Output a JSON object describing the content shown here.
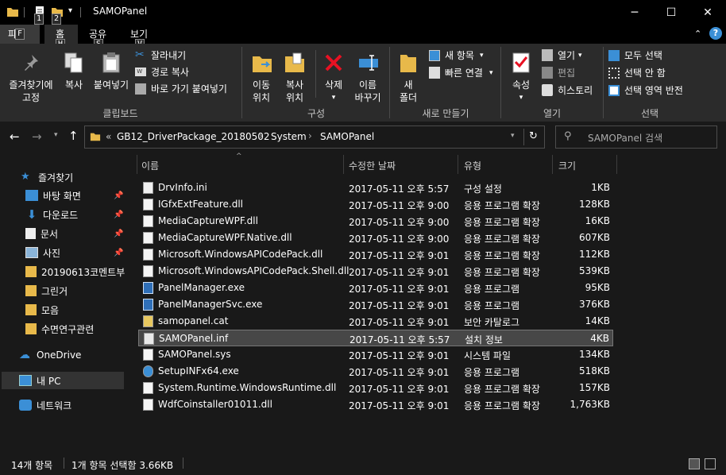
{
  "window": {
    "title": "SAMOPanel",
    "minimize": "─",
    "maximize": "☐",
    "close": "✕"
  },
  "quick_access": {
    "keytips": [
      "1",
      "2"
    ]
  },
  "ribbon_tabs": [
    {
      "label": "파일",
      "keytip": "F"
    },
    {
      "label": "홈",
      "keytip": "H"
    },
    {
      "label": "공유",
      "keytip": "S"
    },
    {
      "label": "보기",
      "keytip": "V"
    }
  ],
  "ribbon": {
    "clipboard": {
      "pin_label": [
        "즐겨찾기에",
        "고정"
      ],
      "copy": "복사",
      "paste": "붙여넣기",
      "cut": "잘라내기",
      "copy_path": "경로 복사",
      "paste_shortcut": "바로 가기 붙여넣기",
      "group": "클립보드"
    },
    "organize": {
      "move_to": [
        "이동",
        "위치"
      ],
      "copy_to": [
        "복사",
        "위치"
      ],
      "delete": "삭제",
      "rename": [
        "이름",
        "바꾸기"
      ],
      "group": "구성"
    },
    "new": {
      "new_folder": [
        "새",
        "폴더"
      ],
      "new_item": "새 항목",
      "easy_access": "빠른 연결",
      "group": "새로 만들기"
    },
    "open": {
      "properties": "속성",
      "open": "열기",
      "edit": "편집",
      "history": "히스토리",
      "group": "열기"
    },
    "select": {
      "select_all": "모두 선택",
      "select_none": "선택 안 함",
      "invert": "선택 영역 반전",
      "group": "선택"
    }
  },
  "address": {
    "overflow": "«",
    "crumbs": [
      "GB12_DriverPackage_20180502",
      "System",
      "SAMOPanel"
    ],
    "search_placeholder": "SAMOPanel 검색"
  },
  "nav": {
    "quick_access": "즐겨찾기",
    "items": [
      {
        "label": "바탕 화면",
        "icon": "desktop-icon",
        "pinned": true
      },
      {
        "label": "다운로드",
        "icon": "download-icon",
        "pinned": true
      },
      {
        "label": "문서",
        "icon": "document-icon",
        "pinned": true
      },
      {
        "label": "사진",
        "icon": "pictures-icon",
        "pinned": true
      },
      {
        "label": "20190613코멘트부",
        "icon": "folder-icon",
        "pinned": false
      },
      {
        "label": "그린거",
        "icon": "folder-icon",
        "pinned": false
      },
      {
        "label": "모음",
        "icon": "folder-icon",
        "pinned": false
      },
      {
        "label": "수면연구관련",
        "icon": "folder-icon",
        "pinned": false
      }
    ],
    "onedrive": "OneDrive",
    "this_pc": "내 PC",
    "network": "네트워크"
  },
  "columns": {
    "name": "이름",
    "modified": "수정한 날짜",
    "type": "유형",
    "size": "크기"
  },
  "files": [
    {
      "name": "DrvInfo.ini",
      "modified": "2017-05-11 오후 5:57",
      "type": "구성 설정",
      "size": "1KB",
      "icon": "ini-file-icon"
    },
    {
      "name": "IGfxExtFeature.dll",
      "modified": "2017-05-11 오후 9:00",
      "type": "응용 프로그램 확장",
      "size": "128KB",
      "icon": "dll-file-icon"
    },
    {
      "name": "MediaCaptureWPF.dll",
      "modified": "2017-05-11 오후 9:00",
      "type": "응용 프로그램 확장",
      "size": "16KB",
      "icon": "dll-file-icon"
    },
    {
      "name": "MediaCaptureWPF.Native.dll",
      "modified": "2017-05-11 오후 9:00",
      "type": "응용 프로그램 확장",
      "size": "607KB",
      "icon": "dll-file-icon"
    },
    {
      "name": "Microsoft.WindowsAPICodePack.dll",
      "modified": "2017-05-11 오후 9:01",
      "type": "응용 프로그램 확장",
      "size": "112KB",
      "icon": "dll-file-icon"
    },
    {
      "name": "Microsoft.WindowsAPICodePack.Shell.dll",
      "modified": "2017-05-11 오후 9:01",
      "type": "응용 프로그램 확장",
      "size": "539KB",
      "icon": "dll-file-icon"
    },
    {
      "name": "PanelManager.exe",
      "modified": "2017-05-11 오후 9:01",
      "type": "응용 프로그램",
      "size": "95KB",
      "icon": "exe-file-icon"
    },
    {
      "name": "PanelManagerSvc.exe",
      "modified": "2017-05-11 오후 9:01",
      "type": "응용 프로그램",
      "size": "376KB",
      "icon": "exe-file-icon"
    },
    {
      "name": "samopanel.cat",
      "modified": "2017-05-11 오후 9:01",
      "type": "보안 카탈로그",
      "size": "14KB",
      "icon": "cat-file-icon"
    },
    {
      "name": "SAMOPanel.inf",
      "modified": "2017-05-11 오후 5:57",
      "type": "설치 정보",
      "size": "4KB",
      "icon": "inf-file-icon"
    },
    {
      "name": "SAMOPanel.sys",
      "modified": "2017-05-11 오후 9:01",
      "type": "시스템 파일",
      "size": "134KB",
      "icon": "sys-file-icon"
    },
    {
      "name": "SetupINFx64.exe",
      "modified": "2017-05-11 오후 9:01",
      "type": "응용 프로그램",
      "size": "518KB",
      "icon": "setup-exe-icon"
    },
    {
      "name": "System.Runtime.WindowsRuntime.dll",
      "modified": "2017-05-11 오후 9:01",
      "type": "응용 프로그램 확장",
      "size": "157KB",
      "icon": "dll-file-icon"
    },
    {
      "name": "WdfCoinstaller01011.dll",
      "modified": "2017-05-11 오후 9:01",
      "type": "응용 프로그램 확장",
      "size": "1,763KB",
      "icon": "dll-file-icon"
    }
  ],
  "selected_row": 9,
  "status": {
    "count": "14개 항목",
    "selection": "1개 항목 선택함 3.66KB"
  },
  "colors": {
    "folder": "#e8b94a",
    "accent": "#3b8fd6",
    "delete_red": "#e81123",
    "selected_bg": "#474747"
  }
}
